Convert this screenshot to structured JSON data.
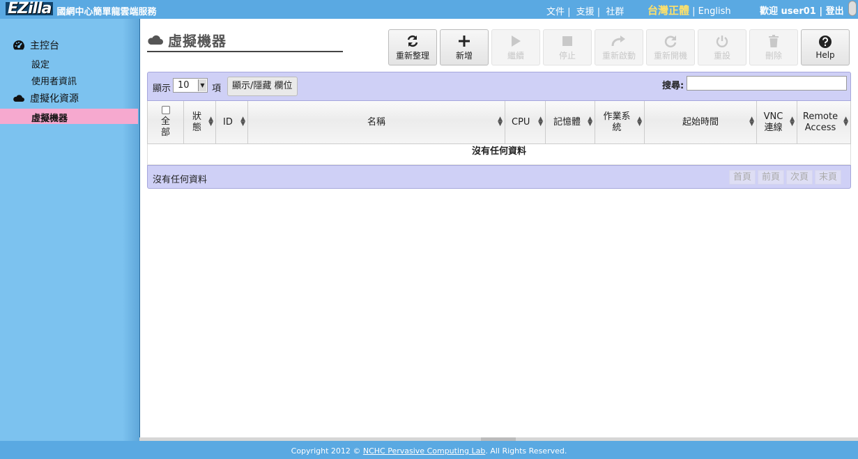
{
  "header": {
    "logo_mark": "EZilla",
    "logo_sub": "國網中心簡單龍雲端服務",
    "links": [
      "文件 |",
      "支援 |",
      "社群"
    ],
    "lang_current": "台灣正體",
    "lang_sep": " | ",
    "lang_other": "English",
    "user_text": "歡迎 user01 | 登出"
  },
  "sidebar": {
    "dashboard_label": "主控台",
    "settings_label": "設定",
    "userinfo_label": "使用者資訊",
    "virtual_label": "虛擬化資源",
    "vm_label": "虛擬機器"
  },
  "page": {
    "title": "虛擬機器"
  },
  "toolbar": {
    "buttons": [
      {
        "label": "重新整理",
        "icon": "refresh-icon",
        "enabled": true
      },
      {
        "label": "新增",
        "icon": "plus-icon",
        "enabled": true
      },
      {
        "label": "繼續",
        "icon": "play-icon",
        "enabled": false
      },
      {
        "label": "停止",
        "icon": "stop-icon",
        "enabled": false
      },
      {
        "label": "重新啟動",
        "icon": "redo-icon",
        "enabled": false
      },
      {
        "label": "重新開機",
        "icon": "reboot-icon",
        "enabled": false
      },
      {
        "label": "重設",
        "icon": "power-icon",
        "enabled": false
      },
      {
        "label": "刪除",
        "icon": "trash-icon",
        "enabled": false
      },
      {
        "label": "Help",
        "icon": "help-icon",
        "enabled": true
      }
    ]
  },
  "table": {
    "show_label": "顯示",
    "page_size": "10",
    "show_unit": "項",
    "column_toggle_label": "顯示/隱藏 欄位",
    "search_label": "搜尋:",
    "search_value": "",
    "columns": [
      {
        "label": "全部"
      },
      {
        "label": "狀態"
      },
      {
        "label": "ID"
      },
      {
        "label": "名稱"
      },
      {
        "label": "CPU"
      },
      {
        "label": "記憶體"
      },
      {
        "label": "作業系統"
      },
      {
        "label": "起始時間"
      },
      {
        "label": "VNC 連線"
      },
      {
        "label": "Remote Access"
      }
    ],
    "empty_text": "沒有任何資料",
    "info_text": "沒有任何資料",
    "pager": [
      "首頁",
      "前頁",
      "次頁",
      "末頁"
    ]
  },
  "footer": {
    "prefix": "Copyright 2012 © ",
    "link": "NCHC Pervasive Computing Lab",
    "suffix": ". All Rights Reserved."
  }
}
